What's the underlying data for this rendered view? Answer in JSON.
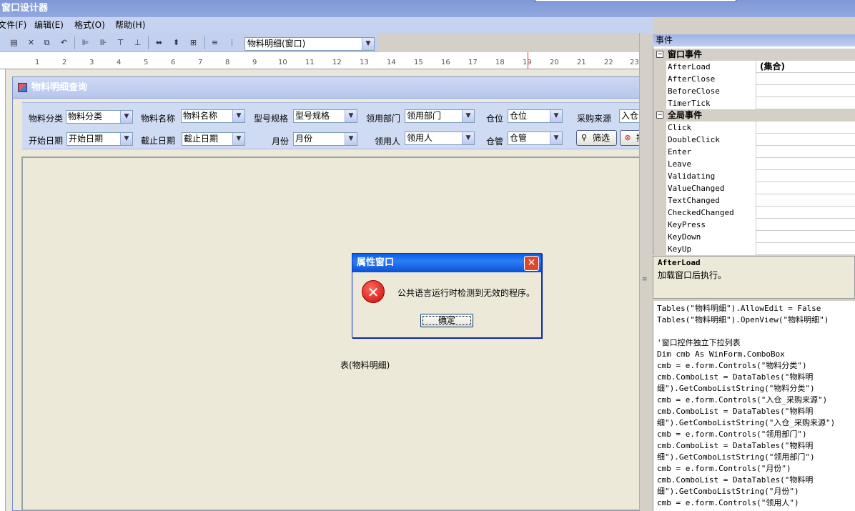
{
  "app": {
    "title": "窗口设计器"
  },
  "menu": [
    "文件(F)",
    "编辑(E)",
    "格式(O)",
    "帮助(H)"
  ],
  "toolbar": {
    "object_selector": "物料明细(窗口)",
    "icons": [
      "select-icon",
      "cut-icon",
      "copy-icon",
      "undo-icon",
      "align-left-icon",
      "align-right-icon",
      "align-top-icon",
      "align-bottom-icon",
      "same-width-icon",
      "same-height-icon",
      "same-size-icon",
      "vertical-spacing-icon",
      "horizontal-spacing-icon"
    ]
  },
  "ruler": {
    "marks": [
      "1",
      "2",
      "3",
      "4",
      "5",
      "6",
      "7",
      "8",
      "9",
      "10",
      "11",
      "12",
      "13",
      "14",
      "15",
      "16",
      "17",
      "18",
      "19",
      "20",
      "21",
      "22",
      "23"
    ]
  },
  "form": {
    "title": "物料明细查询",
    "row1": [
      {
        "label": "物料分类",
        "value": "物料分类"
      },
      {
        "label": "物料名称",
        "value": "物料名称"
      },
      {
        "label": "型号规格",
        "value": "型号规格"
      },
      {
        "label": "领用部门",
        "value": "领用部门"
      },
      {
        "label": "仓位",
        "value": "仓位"
      },
      {
        "label": "采购来源",
        "value": "入仓"
      }
    ],
    "row2": [
      {
        "label": "开始日期",
        "value": "开始日期"
      },
      {
        "label": "截止日期",
        "value": "截止日期"
      },
      {
        "label": "月份",
        "value": "月份"
      },
      {
        "label": "领用人",
        "value": "领用人"
      },
      {
        "label": "仓管",
        "value": "仓管"
      }
    ],
    "filter_button": "筛选",
    "second_button": "撤",
    "grid_label": "表(物料明细)"
  },
  "events": {
    "header": "事件",
    "categories": [
      {
        "name": "窗口事件",
        "items": [
          {
            "name": "AfterLoad",
            "value": "(集合)"
          },
          {
            "name": "AfterClose",
            "value": ""
          },
          {
            "name": "BeforeClose",
            "value": ""
          },
          {
            "name": "TimerTick",
            "value": ""
          }
        ]
      },
      {
        "name": "全局事件",
        "items": [
          {
            "name": "Click",
            "value": ""
          },
          {
            "name": "DoubleClick",
            "value": ""
          },
          {
            "name": "Enter",
            "value": ""
          },
          {
            "name": "Leave",
            "value": ""
          },
          {
            "name": "Validating",
            "value": ""
          },
          {
            "name": "ValueChanged",
            "value": ""
          },
          {
            "name": "TextChanged",
            "value": ""
          },
          {
            "name": "CheckedChanged",
            "value": ""
          },
          {
            "name": "KeyPress",
            "value": ""
          },
          {
            "name": "KeyDown",
            "value": ""
          },
          {
            "name": "KeyUp",
            "value": ""
          }
        ]
      }
    ],
    "description_title": "AfterLoad",
    "description_text": "加载窗口后执行。"
  },
  "code": [
    "Tables(\"物料明细\").AllowEdit = False",
    "Tables(\"物料明细\").OpenView(\"物料明细\")",
    "",
    "'窗口控件独立下拉列表",
    "Dim cmb As WinForm.ComboBox",
    "cmb = e.form.Controls(\"物料分类\")",
    "cmb.ComboList = DataTables(\"物料明",
    "细\").GetComboListString(\"物料分类\")",
    "cmb = e.form.Controls(\"入仓_采购来源\")",
    "cmb.ComboList = DataTables(\"物料明",
    "细\").GetComboListString(\"入仓_采购来源\")",
    "cmb = e.form.Controls(\"领用部门\")",
    "cmb.ComboList = DataTables(\"物料明",
    "细\").GetComboListString(\"领用部门\")",
    "cmb = e.form.Controls(\"月份\")",
    "cmb.ComboList = DataTables(\"物料明",
    "细\").GetComboListString(\"月份\")",
    "cmb = e.form.Controls(\"领用人\")"
  ],
  "dialog": {
    "title": "属性窗口",
    "message": "公共语言运行时检测到无效的程序。",
    "ok": "确定",
    "icon": "error-icon"
  },
  "colors": {
    "dialog_title": "#0a5ce8",
    "error": "#c80a0a",
    "accent": "#7f98d6"
  }
}
